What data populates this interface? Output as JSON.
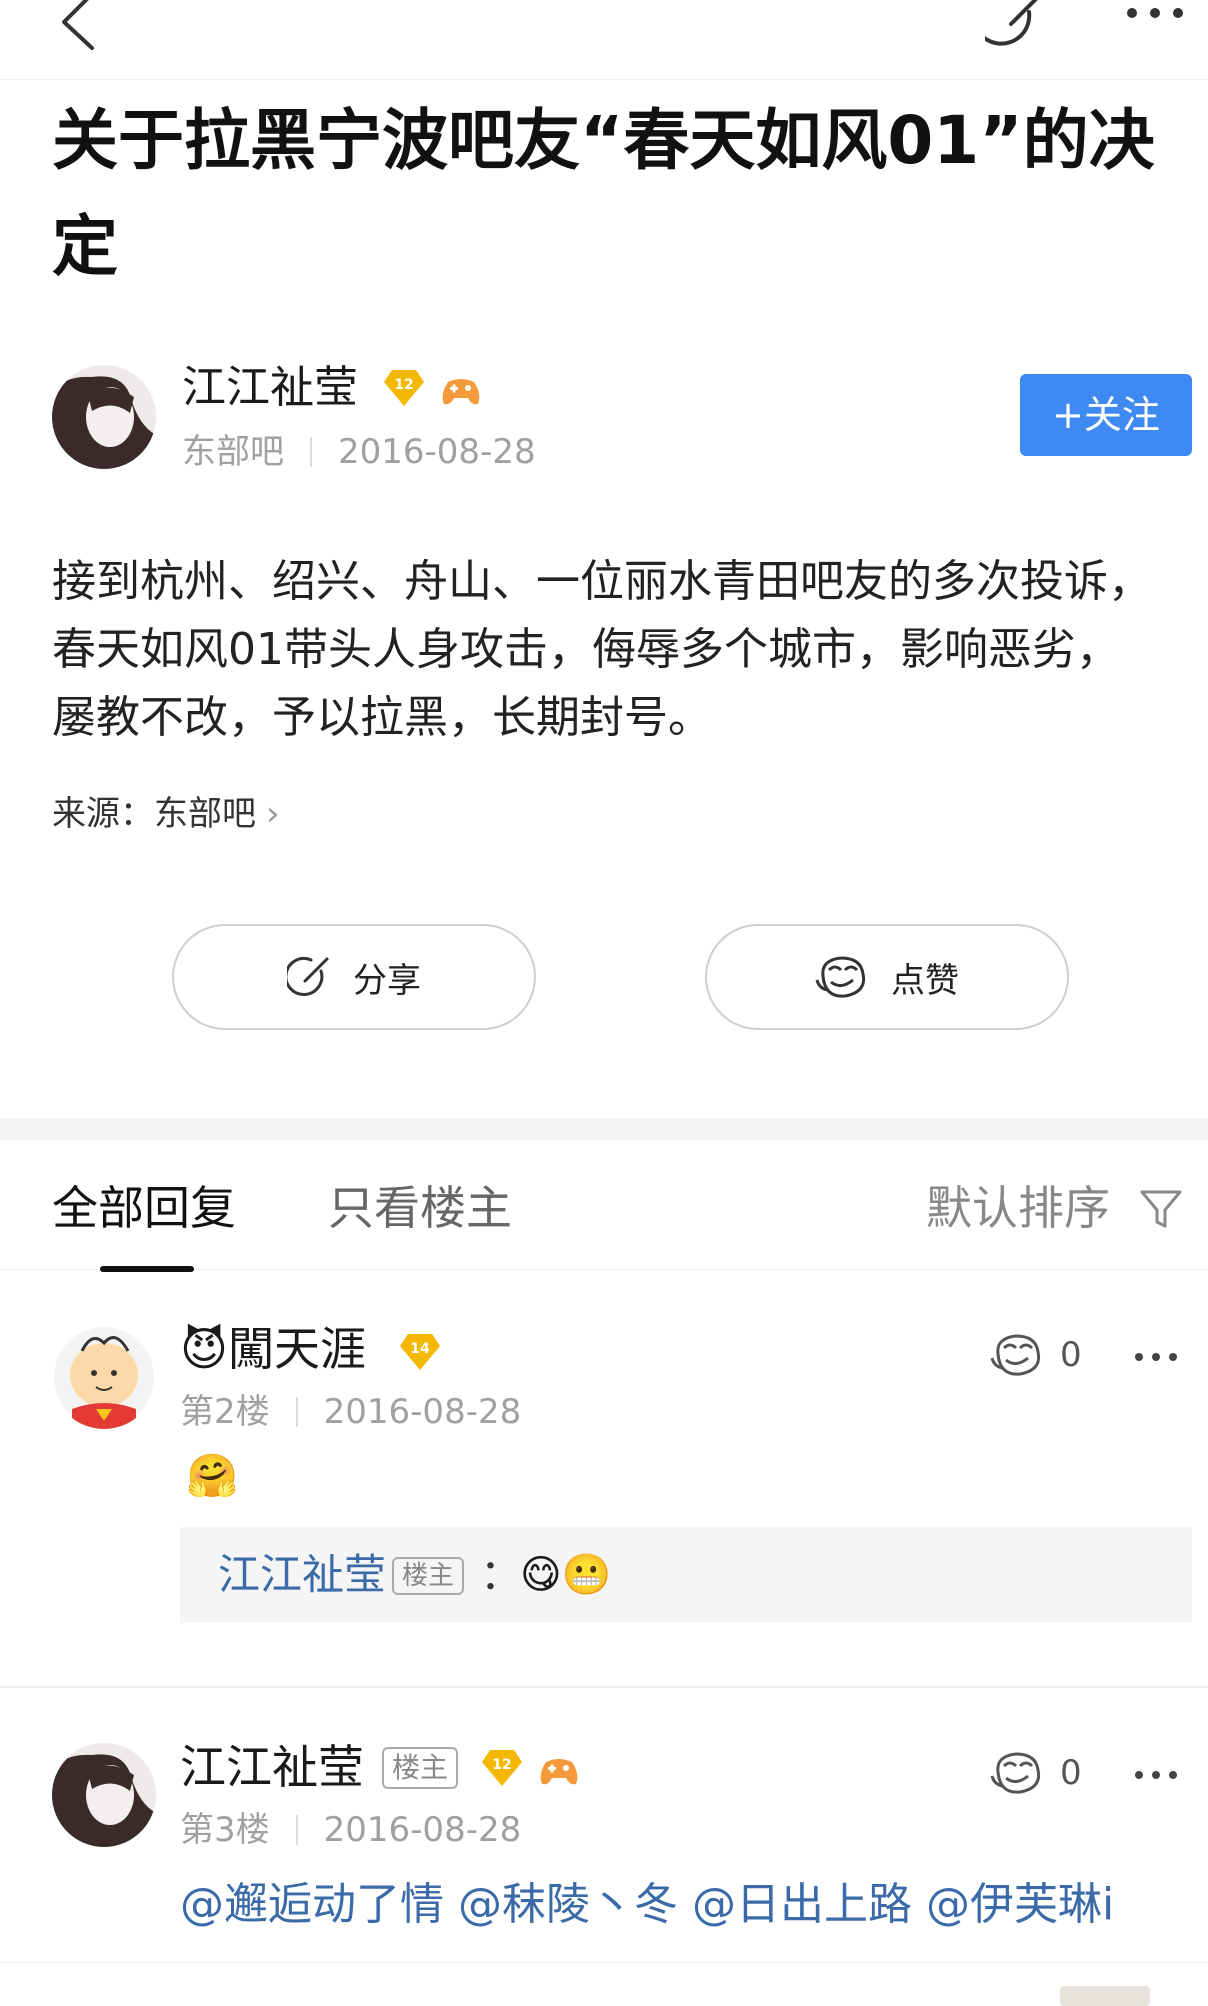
{
  "post": {
    "title": "关于拉黑宁波吧友“春天如风01”的决定",
    "author": {
      "name": "江江祉莹",
      "level": "12",
      "forum": "东部吧",
      "date": "2016-08-28"
    },
    "follow_label": "+关注",
    "body": "接到杭州、绍兴、舟山、一位丽水青田吧友的多次投诉，春天如风01带头人身攻击，侮辱多个城市，影响恶劣，屡教不改，予以拉黑，长期封号。",
    "source_label": "来源：",
    "source_name": "东部吧",
    "source_chevron": "›",
    "share_label": "分享",
    "like_label": "点赞"
  },
  "tabs": {
    "all_replies": "全部回复",
    "op_only": "只看楼主",
    "sort_label": "默认排序"
  },
  "replies": [
    {
      "emoji": "😈",
      "name": "闖天涯",
      "level": "14",
      "floor": "第2楼",
      "date": "2016-08-28",
      "likes": "0",
      "content_emoji": "🤗",
      "quote": {
        "name": "江江祉莹",
        "tag": "楼主",
        "colon": "：",
        "emojis": "😋😬"
      }
    },
    {
      "name": "江江祉莹",
      "tag": "楼主",
      "level": "12",
      "floor": "第3楼",
      "date": "2016-08-28",
      "likes": "0",
      "mentions": "@邂逅动了情 @秣陵丶冬 @日出上路 @伊芙琳i"
    }
  ],
  "colors": {
    "accent": "#3f89f3",
    "link": "#3a6aa8",
    "level_badge": "#f5b800"
  }
}
